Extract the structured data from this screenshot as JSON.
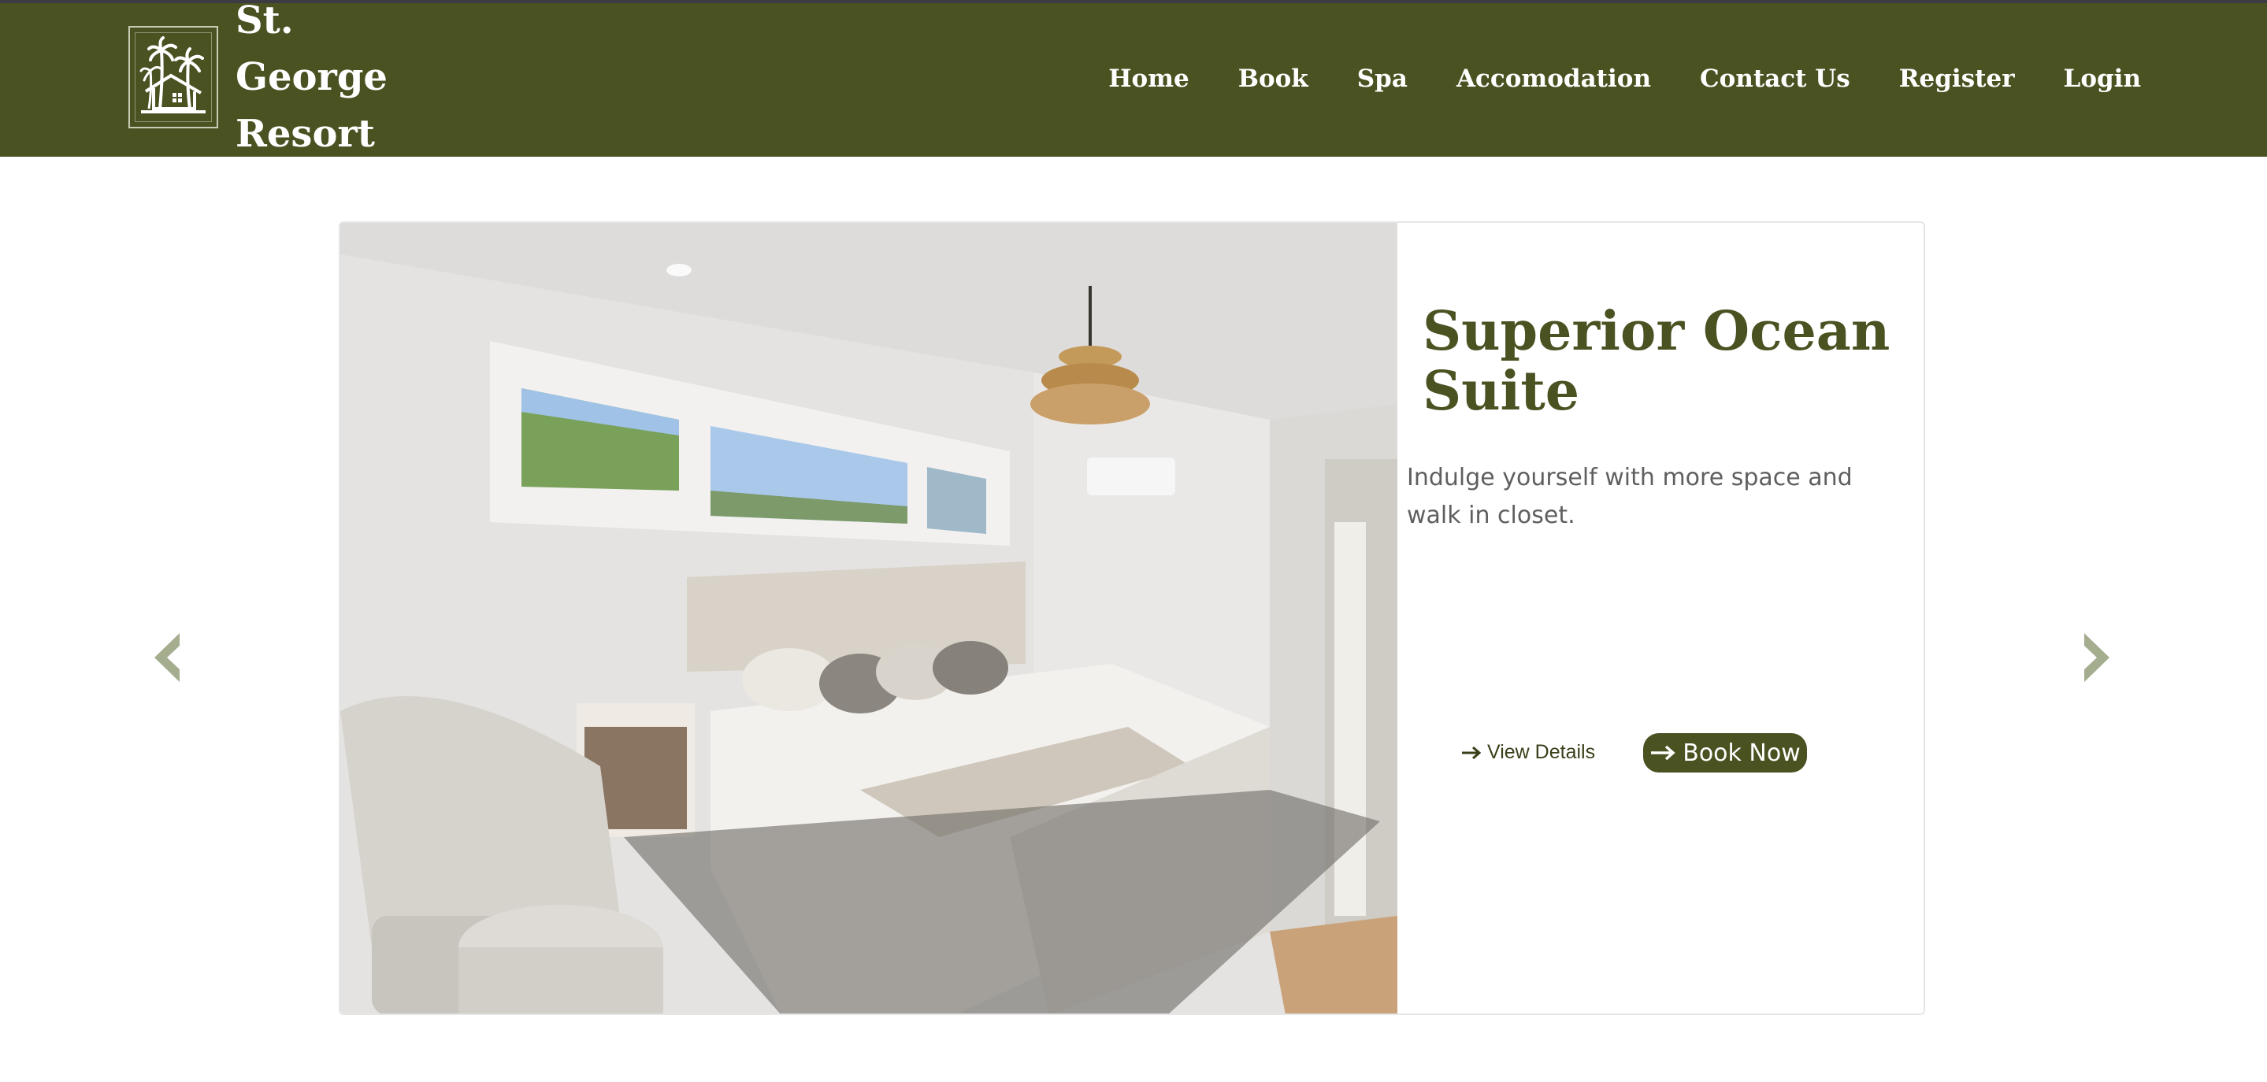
{
  "brand": {
    "name": "St. George Resort",
    "logo_icon": "palm-house-icon"
  },
  "nav": {
    "items": [
      "Home",
      "Book",
      "Spa",
      "Accomodation",
      "Contact Us",
      "Register",
      "Login"
    ]
  },
  "carousel": {
    "prev_icon": "chevron-left-icon",
    "next_icon": "chevron-right-icon",
    "slide": {
      "title": "Superior Ocean Suite",
      "description": "Indulge yourself with more space and walk in closet.",
      "view_details_label": "View Details",
      "book_now_label": "Book Now",
      "image_icon": "bedroom-photo"
    }
  },
  "colors": {
    "brand": "#4a5222",
    "arrow": "#a5ad8f",
    "title": "#4a5222"
  }
}
